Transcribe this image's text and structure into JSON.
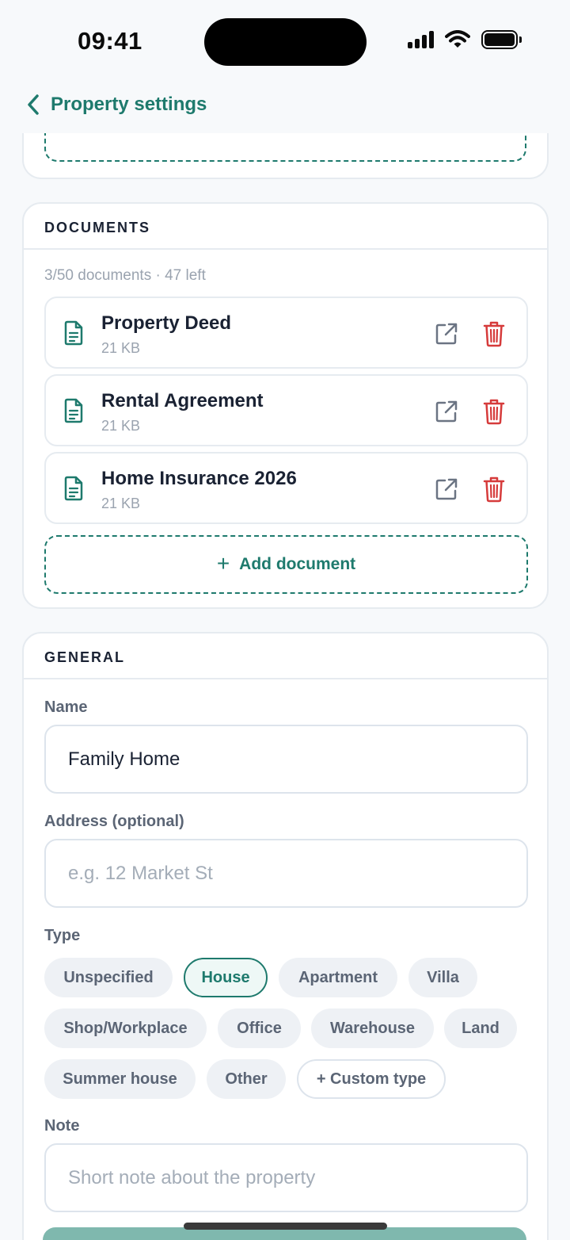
{
  "status_bar": {
    "time": "09:41"
  },
  "nav": {
    "back_label": "Property settings"
  },
  "documents": {
    "title": "DOCUMENTS",
    "count_text": "3/50 documents · 47 left",
    "items": [
      {
        "name": "Property Deed",
        "size": "21 KB"
      },
      {
        "name": "Rental Agreement",
        "size": "21 KB"
      },
      {
        "name": "Home Insurance 2026",
        "size": "21 KB"
      }
    ],
    "add_label": "Add document"
  },
  "general": {
    "title": "GENERAL",
    "name_label": "Name",
    "name_value": "Family Home",
    "address_label": "Address (optional)",
    "address_placeholder": "e.g. 12 Market St",
    "type_label": "Type",
    "types": [
      "Unspecified",
      "House",
      "Apartment",
      "Villa",
      "Shop/Workplace",
      "Office",
      "Warehouse",
      "Land",
      "Summer house",
      "Other"
    ],
    "selected_type": "House",
    "custom_type_label": "+ Custom type",
    "note_label": "Note",
    "note_placeholder": "Short note about the property"
  },
  "colors": {
    "accent": "#1e7a6d",
    "danger": "#d63b3b",
    "muted": "#9aa3af",
    "save_button": "#7fb8ae"
  },
  "icons": {
    "back": "chevron-left-icon",
    "file": "file-text-icon",
    "open": "external-link-icon",
    "delete": "trash-icon",
    "add": "plus-icon"
  }
}
